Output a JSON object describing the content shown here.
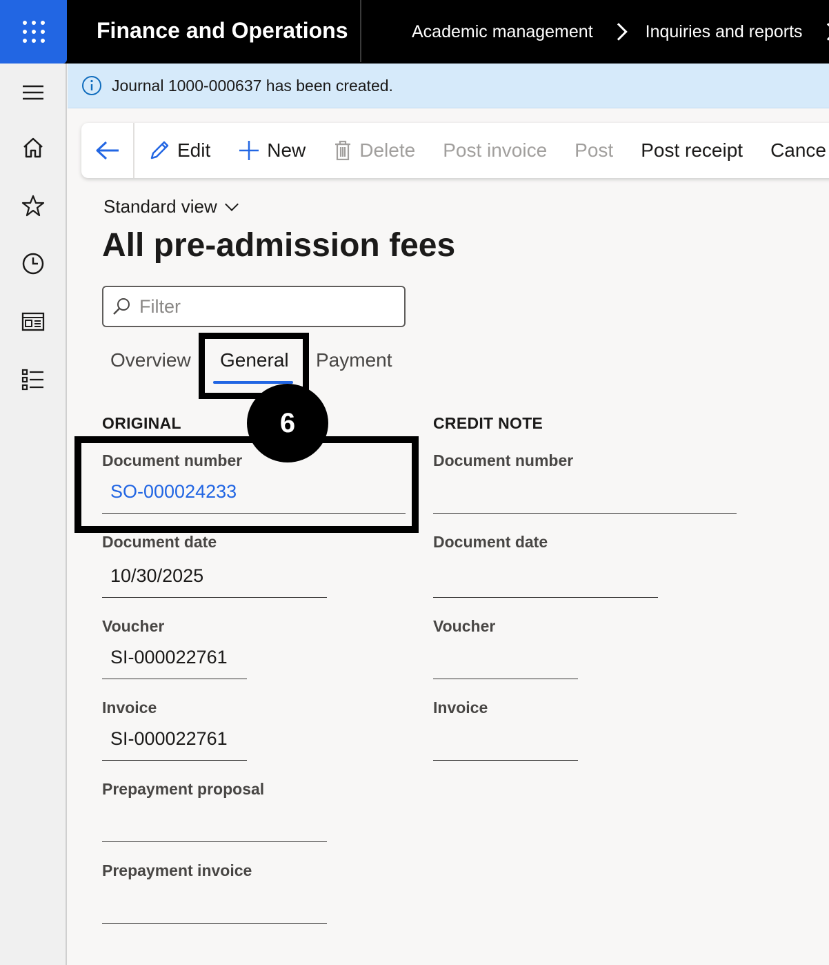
{
  "topbar": {
    "app_title": "Finance and Operations",
    "breadcrumb": [
      "Academic management",
      "Inquiries and reports"
    ]
  },
  "nav": {
    "items": [
      "menu-icon",
      "home-icon",
      "favorites-icon",
      "recent-icon",
      "workspaces-icon",
      "modules-icon"
    ]
  },
  "message": {
    "text": "Journal 1000-000637 has been created."
  },
  "actions": {
    "edit": "Edit",
    "new": "New",
    "delete": "Delete",
    "post_invoice": "Post invoice",
    "post": "Post",
    "post_receipt": "Post receipt",
    "cancel": "Cance"
  },
  "view": {
    "selector": "Standard view",
    "title": "All pre-admission fees"
  },
  "filter": {
    "placeholder": "Filter"
  },
  "tabs": {
    "overview": "Overview",
    "general": "General",
    "payment": "Payment",
    "active": "General"
  },
  "annotation": {
    "step": "6"
  },
  "original": {
    "heading": "ORIGINAL",
    "document_number_label": "Document number",
    "document_number": "SO-000024233",
    "document_date_label": "Document date",
    "document_date": "10/30/2025",
    "voucher_label": "Voucher",
    "voucher": "SI-000022761",
    "invoice_label": "Invoice",
    "invoice": "SI-000022761",
    "prepayment_proposal_label": "Prepayment proposal",
    "prepayment_proposal": "",
    "prepayment_invoice_label": "Prepayment invoice",
    "prepayment_invoice": ""
  },
  "credit_note": {
    "heading": "CREDIT NOTE",
    "document_number_label": "Document number",
    "document_number": "",
    "document_date_label": "Document date",
    "document_date": "",
    "voucher_label": "Voucher",
    "voucher": "",
    "invoice_label": "Invoice",
    "invoice": ""
  },
  "colors": {
    "accent": "#2266e3",
    "message_bar": "#d6eafa",
    "topbar": "#000000"
  }
}
